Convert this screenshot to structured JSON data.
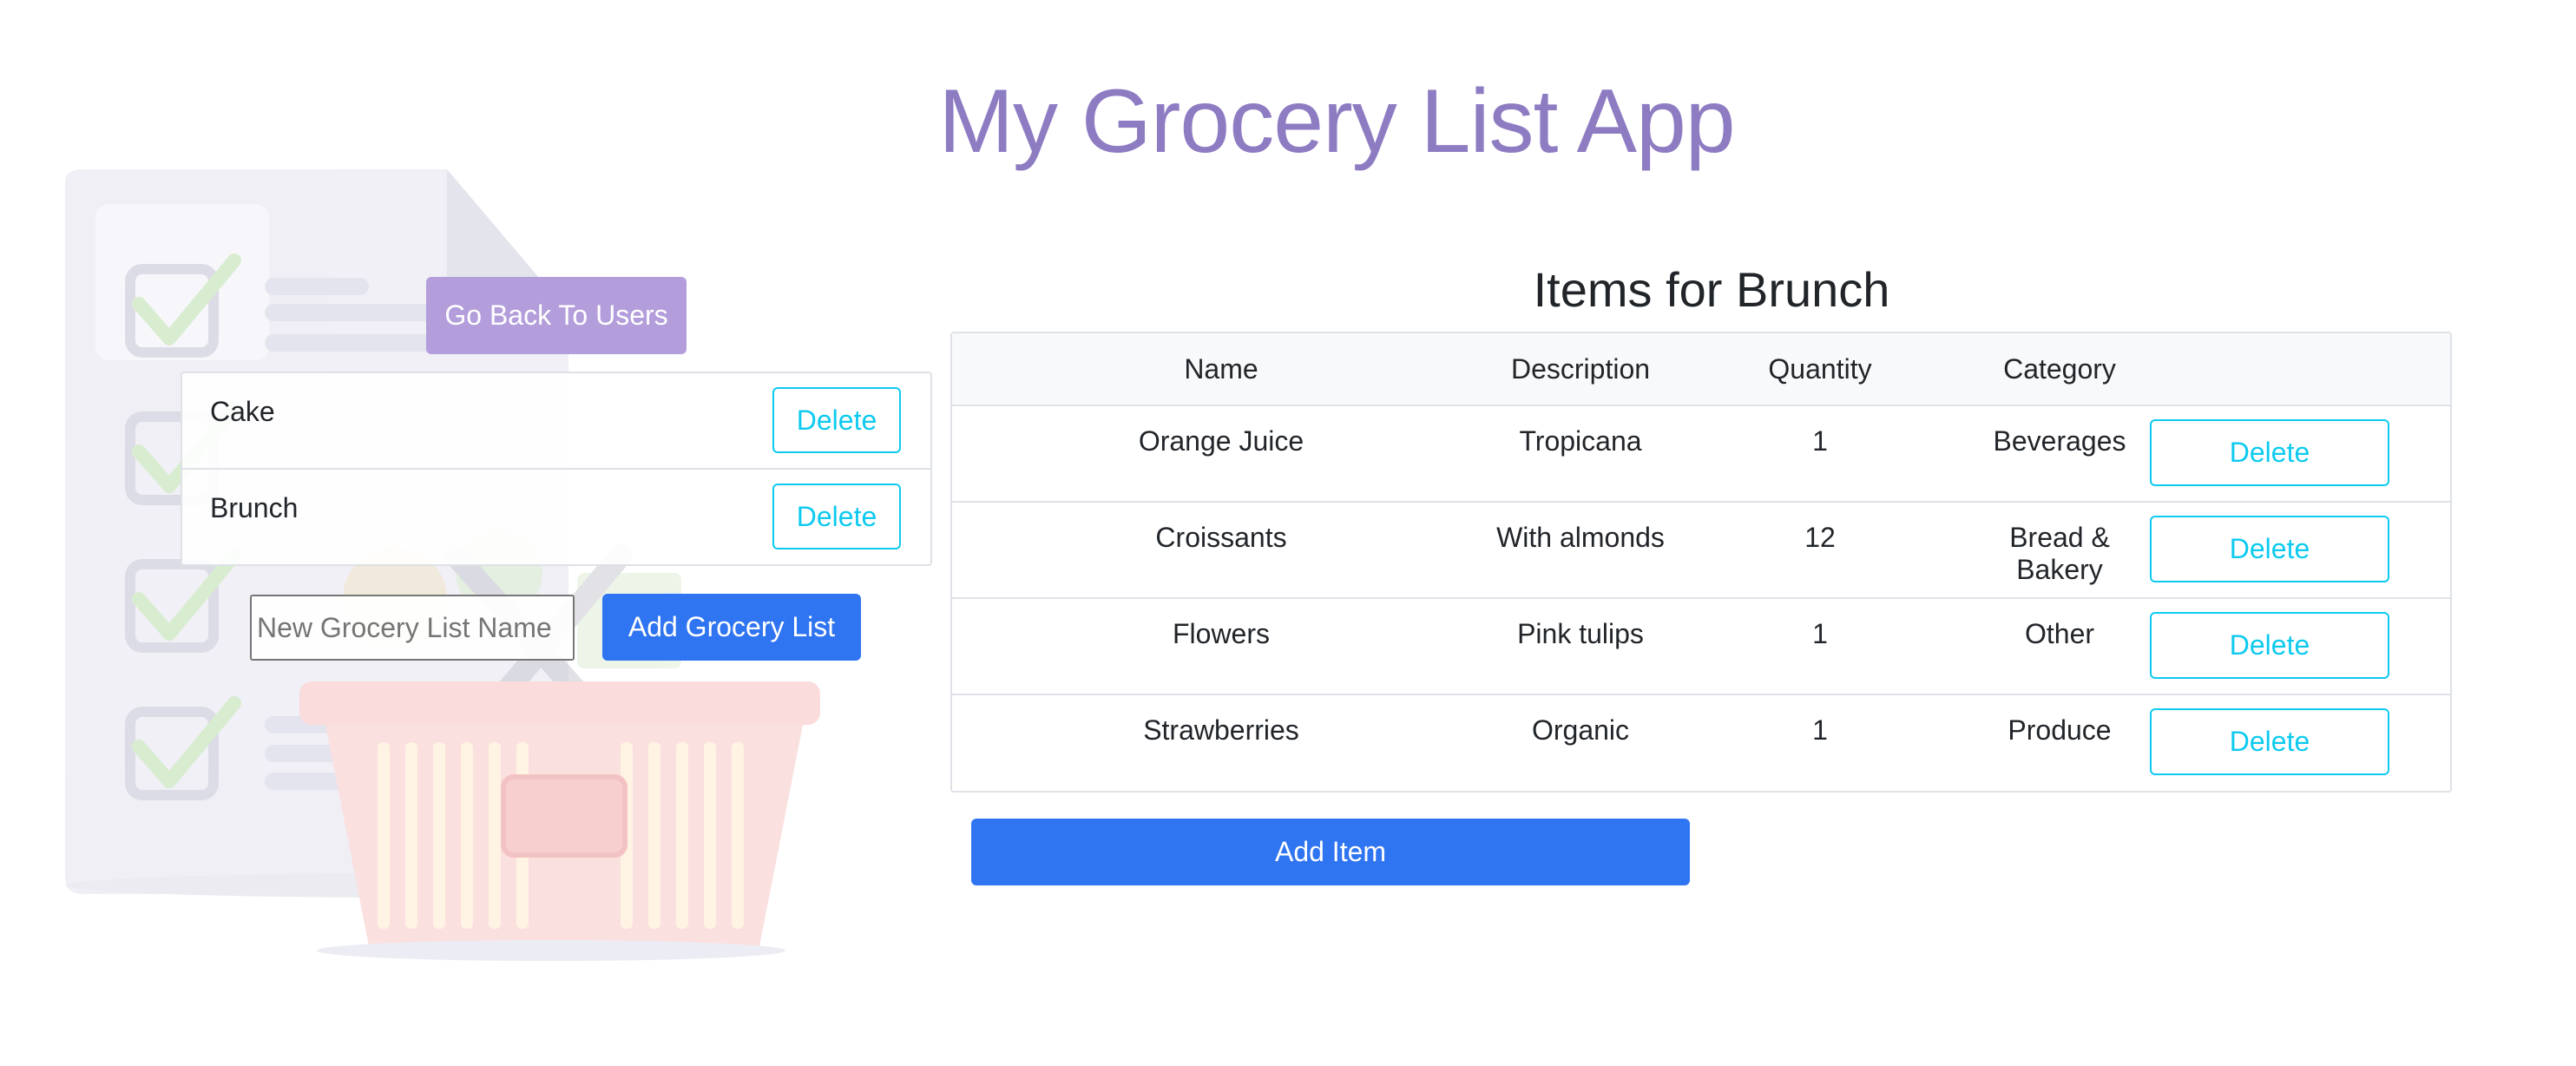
{
  "app": {
    "title": "My Grocery List App"
  },
  "colors": {
    "title": "#8e7cc3",
    "back_button": "#b39ddb",
    "primary": "#2f74f0",
    "outline_info": "#0dcaf0"
  },
  "left_panel": {
    "back_button_label": "Go Back To Users",
    "grocery_lists": [
      {
        "name": "Cake",
        "delete_label": "Delete"
      },
      {
        "name": "Brunch",
        "delete_label": "Delete"
      }
    ],
    "new_list_placeholder": "New Grocery List Name",
    "new_list_value": "",
    "add_list_label": "Add Grocery List"
  },
  "items_panel": {
    "heading": "Items for Brunch",
    "columns": [
      "Name",
      "Description",
      "Quantity",
      "Category",
      ""
    ],
    "rows": [
      {
        "name": "Orange Juice",
        "description": "Tropicana",
        "quantity": "1",
        "category": "Beverages",
        "delete_label": "Delete"
      },
      {
        "name": "Croissants",
        "description": "With almonds",
        "quantity": "12",
        "category": "Bread & Bakery",
        "delete_label": "Delete"
      },
      {
        "name": "Flowers",
        "description": "Pink tulips",
        "quantity": "1",
        "category": "Other",
        "delete_label": "Delete"
      },
      {
        "name": "Strawberries",
        "description": "Organic",
        "quantity": "1",
        "category": "Produce",
        "delete_label": "Delete"
      }
    ],
    "add_item_label": "Add Item"
  },
  "icons": {
    "background": "grocery-checklist-basket-illustration"
  }
}
